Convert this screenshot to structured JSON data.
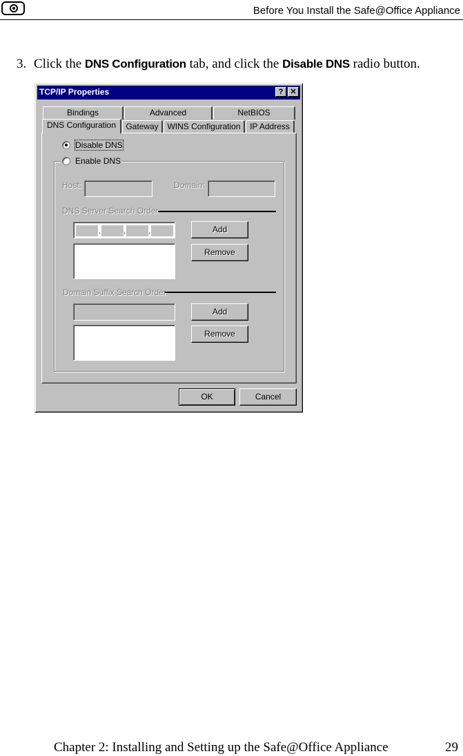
{
  "header": {
    "logo_icon": "check-point-logo-icon",
    "title": "Before You Install the Safe@Office Appliance"
  },
  "step": {
    "number": "3.",
    "text_before": "Click the ",
    "tab_name": "DNS Configuration",
    "text_middle": " tab, and click the ",
    "radio_name": "Disable DNS",
    "text_after": " radio button."
  },
  "dialog": {
    "title": "TCP/IP Properties",
    "help_button": "?",
    "close_button": "✕",
    "tabs_back": [
      "Bindings",
      "Advanced",
      "NetBIOS"
    ],
    "tabs_front": [
      "DNS Configuration",
      "Gateway",
      "WINS Configuration",
      "IP Address"
    ],
    "active_tab": "DNS Configuration",
    "disable_dns_label": "Disable DNS",
    "enable_dns_label": "Enable DNS",
    "disable_dns_selected": true,
    "host_label": "Host:",
    "domain_label": "Domain:",
    "dns_server_order_label": "DNS Server Search Order",
    "domain_suffix_order_label": "Domain Suffix Search Order",
    "add_label": "Add",
    "remove_label": "Remove",
    "ok_label": "OK",
    "cancel_label": "Cancel"
  },
  "footer": {
    "chapter": "Chapter 2: Installing and Setting up the Safe@Office Appliance",
    "page_number": "29"
  }
}
